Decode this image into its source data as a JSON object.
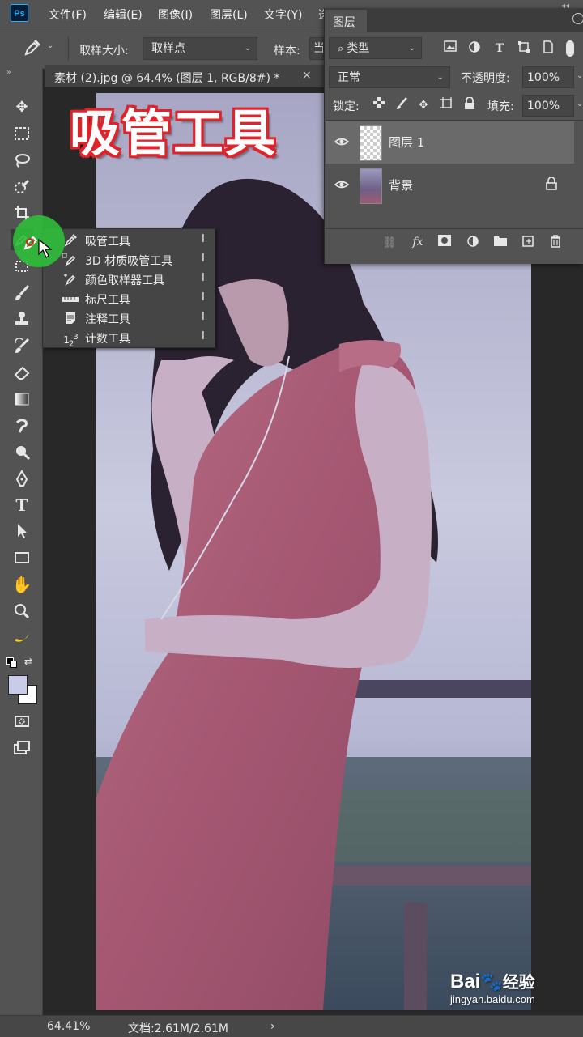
{
  "app": {
    "logo_text": "Ps"
  },
  "menubar": {
    "items": [
      "文件(F)",
      "编辑(E)",
      "图像(I)",
      "图层(L)",
      "文字(Y)",
      "选"
    ]
  },
  "options_bar": {
    "sample_size_label": "取样大小:",
    "sample_size_value": "取样点",
    "sample_label": "样本:",
    "sample_value_partial": "当"
  },
  "document": {
    "tab_title": "素材 (2).jpg @ 64.4% (图层 1, RGB/8#) *",
    "close_glyph": "×"
  },
  "overlay_title": "吸管工具",
  "flyout": {
    "items": [
      {
        "label": "吸管工具",
        "key": "I",
        "icon": "eyedropper-icon"
      },
      {
        "label": "3D 材质吸管工具",
        "key": "I",
        "icon": "3d-material-eyedropper-icon"
      },
      {
        "label": "颜色取样器工具",
        "key": "I",
        "icon": "color-sampler-icon"
      },
      {
        "label": "标尺工具",
        "key": "I",
        "icon": "ruler-icon"
      },
      {
        "label": "注释工具",
        "key": "I",
        "icon": "note-icon"
      },
      {
        "label": "计数工具",
        "key": "I",
        "icon": "count-icon"
      }
    ]
  },
  "layers_panel": {
    "tab_title": "图层",
    "filter_kind": "类型",
    "blend_mode": "正常",
    "opacity_label": "不透明度:",
    "opacity_value": "100%",
    "lock_label": "锁定:",
    "fill_label": "填充:",
    "fill_value": "100%",
    "layers": [
      {
        "name": "图层 1",
        "visible": true,
        "selected": true,
        "locked": false
      },
      {
        "name": "背景",
        "visible": true,
        "selected": false,
        "locked": true
      }
    ]
  },
  "status": {
    "zoom": "64.41%",
    "doc_size": "文档:2.61M/2.61M",
    "arrow": "›"
  },
  "watermark": {
    "brand": "Bai",
    "brand_suffix": "经验",
    "url": "jingyan.baidu.com"
  },
  "colors": {
    "accent": "#31a8ff",
    "panel_bg": "#535353",
    "title_red": "#e0222a",
    "cursor_green": "#2fbf3a"
  }
}
